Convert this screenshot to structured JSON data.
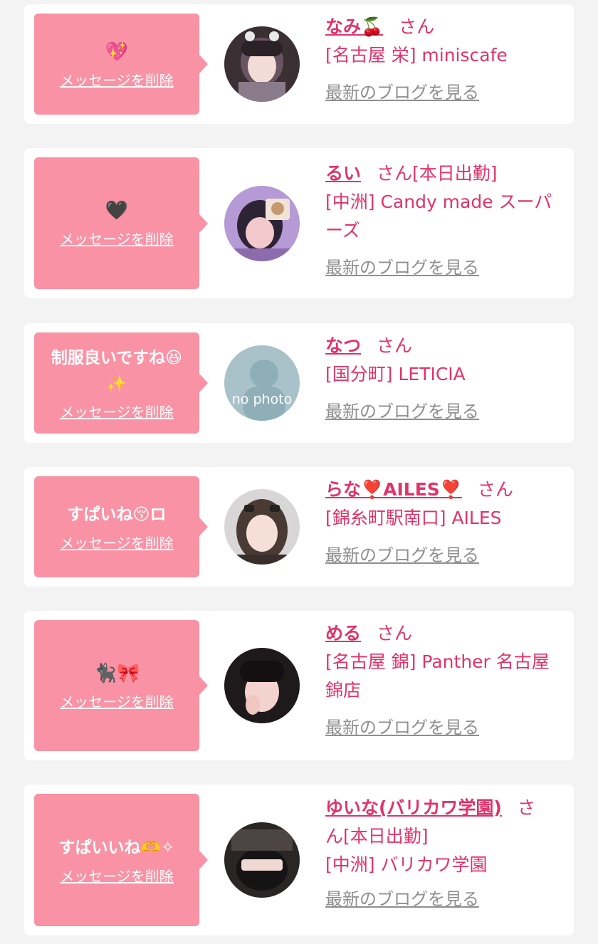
{
  "colors": {
    "accent": "#e0336a",
    "bubble": "#f992a4",
    "muted": "#8f8f8f",
    "background": "#f3f3f3"
  },
  "delete_label": "メッセージを削除",
  "blog_label": "最新のブログを見る",
  "entries": [
    {
      "message": "💖",
      "name": "なみ🍒",
      "suffix": "さん",
      "shop_lines": [
        "[名古屋 栄] miniscafe"
      ],
      "avatar_icon": "profile-photo"
    },
    {
      "message": "🖤",
      "name": "るい",
      "suffix": "さん[本日出勤]",
      "shop_lines": [
        "[中洲] Candy made スーパ",
        "ーズ"
      ],
      "avatar_icon": "profile-photo"
    },
    {
      "message": "制服良いですね😆✨",
      "name": "なつ",
      "suffix": "さん",
      "shop_lines": [
        "[国分町] LETICIA"
      ],
      "avatar_icon": "no-photo",
      "avatar_text": "no photo"
    },
    {
      "message": "すぱいね😚ロ",
      "name": "らな❣️AILES❣️",
      "suffix": "さん",
      "shop_lines": [
        "[錦糸町駅南口] AILES"
      ],
      "avatar_icon": "profile-photo"
    },
    {
      "message": "🐈‍⬛🎀",
      "name": "める",
      "suffix": "さん",
      "shop_lines": [
        "[名古屋 錦] Panther 名古屋",
        "錦店"
      ],
      "avatar_icon": "profile-photo"
    },
    {
      "message": "すぱいいね🫶✧",
      "name": "ゆいな(バリカワ学園)",
      "suffix": "さ",
      "name_line2": "ん[本日出勤]",
      "shop_lines": [
        "[中洲] バリカワ学園"
      ],
      "avatar_icon": "profile-photo"
    }
  ]
}
